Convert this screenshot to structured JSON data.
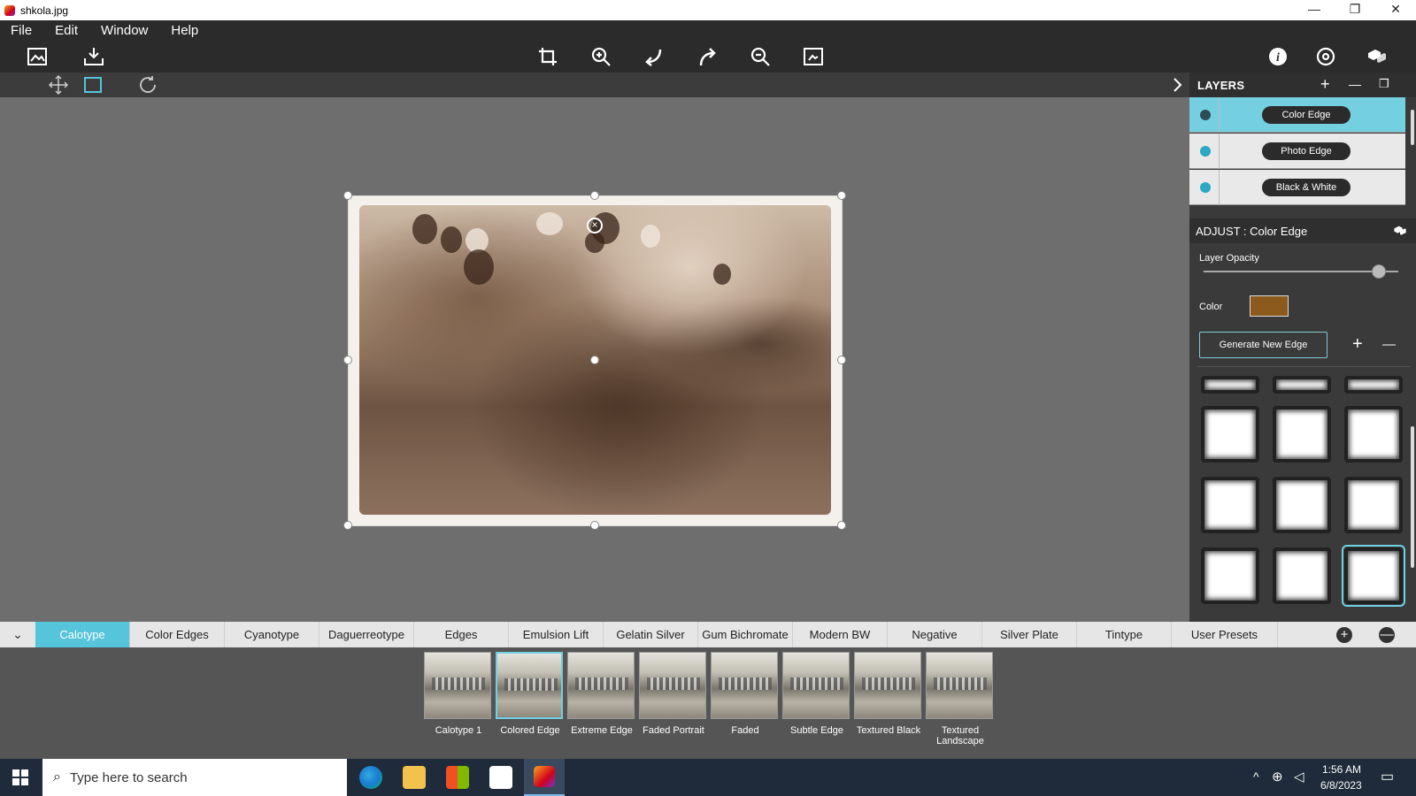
{
  "window": {
    "title": "shkola.jpg",
    "controls": [
      "—",
      "❐",
      "✕"
    ]
  },
  "menu": [
    "File",
    "Edit",
    "Window",
    "Help"
  ],
  "layers": {
    "header": "LAYERS",
    "add": "+",
    "remove": "—",
    "items": [
      "Color Edge",
      "Photo Edge",
      "Black & White"
    ],
    "active_index": 0
  },
  "adjust": {
    "header": "ADJUST : Color Edge",
    "opacity_label": "Layer Opacity",
    "opacity_value": 0.9,
    "color_label": "Color",
    "color_value": "#8b5a1c",
    "generate_button": "Generate New Edge",
    "add": "+",
    "remove": "—",
    "selected_edge_index": 11
  },
  "preset_tabs": [
    "Calotype",
    "Color Edges",
    "Cyanotype",
    "Daguerreotype",
    "Edges",
    "Emulsion Lift",
    "Gelatin Silver",
    "Gum Bichromate",
    "Modern BW",
    "Negative",
    "Silver Plate",
    "Tintype",
    "User Presets"
  ],
  "active_tab": "Calotype",
  "tab_controls": {
    "add": "+",
    "remove": "—"
  },
  "presets": [
    "Calotype 1",
    "Colored Edge",
    "Extreme Edge",
    "Faded Portrait",
    "Faded",
    "Subtle Edge",
    "Textured Black",
    "Textured Landscape"
  ],
  "selected_preset": "Colored Edge",
  "taskbar": {
    "search_placeholder": "Type here to search",
    "time": "1:56 AM",
    "date": "6/8/2023"
  },
  "colors": {
    "accent": "#56c4db",
    "toolbar": "#2b2b2b",
    "canvas": "#6e6e6e"
  }
}
